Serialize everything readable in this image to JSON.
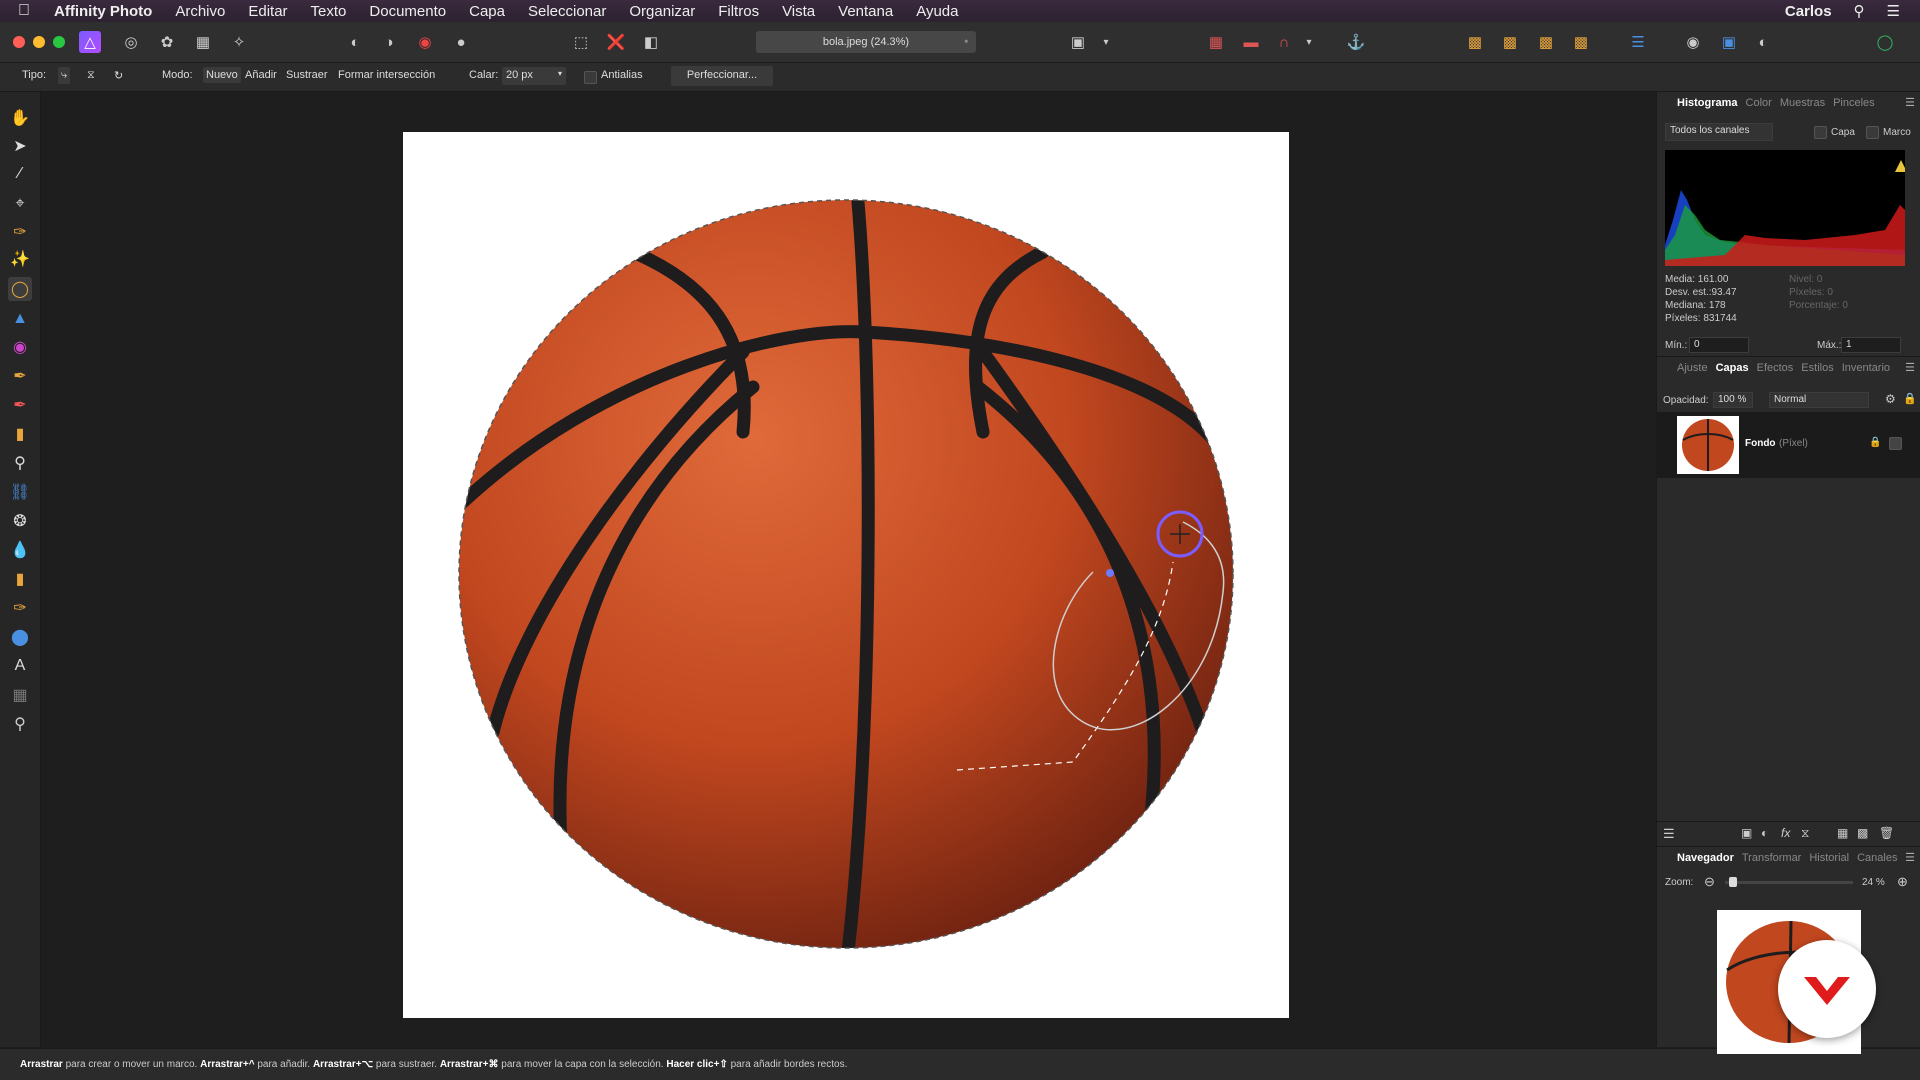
{
  "menubar": {
    "app_name": "Affinity Photo",
    "items": [
      "Archivo",
      "Editar",
      "Texto",
      "Documento",
      "Capa",
      "Seleccionar",
      "Organizar",
      "Filtros",
      "Vista",
      "Ventana",
      "Ayuda"
    ],
    "user": "Carlos"
  },
  "toolbar": {
    "document_tab": "bola.jpeg (24.3%)"
  },
  "context_bar": {
    "type_label": "Tipo:",
    "mode_label": "Modo:",
    "modes": [
      "Nuevo",
      "Añadir",
      "Sustraer",
      "Formar intersección"
    ],
    "feather_label": "Calar:",
    "feather_value": "20 px",
    "antialias_label": "Antialias",
    "refine_button": "Perfeccionar..."
  },
  "status_bar": {
    "parts": [
      {
        "bold": "Arrastrar",
        "text": " para crear o mover un marco. "
      },
      {
        "bold": "Arrastrar+^",
        "text": " para añadir. "
      },
      {
        "bold": "Arrastrar+⌥",
        "text": " para sustraer. "
      },
      {
        "bold": "Arrastrar+⌘",
        "text": " para mover la capa con la selección. "
      },
      {
        "bold": "Hacer clic+⇧",
        "text": " para añadir bordes rectos."
      }
    ]
  },
  "panels": {
    "top_tabs": [
      "Histograma",
      "Color",
      "Muestras",
      "Pinceles"
    ],
    "channels_select": "Todos los canales",
    "layer_checkbox": "Capa",
    "frame_checkbox": "Marco",
    "stats": {
      "media": "Media: 161.00",
      "desv": "Desv. est.:93.47",
      "mediana": "Mediana: 178",
      "pixeles": "Píxeles: 831744",
      "nivel": "Nivel: 0",
      "pixeles_r": "Píxeles: 0",
      "porcentaje": "Porcentaje: 0"
    },
    "min_label": "Mín.:",
    "min_value": "0",
    "max_label": "Máx.:",
    "max_value": "1",
    "mid_tabs": [
      "Ajuste",
      "Capas",
      "Efectos",
      "Estilos",
      "Inventario"
    ],
    "opacity_label": "Opacidad:",
    "opacity_value": "100 %",
    "blend_mode": "Normal",
    "layer_name": "Fondo",
    "layer_type": "(Píxel)",
    "bottom_tabs": [
      "Navegador",
      "Transformar",
      "Historial",
      "Canales"
    ],
    "zoom_label": "Zoom:",
    "zoom_value": "24 %"
  },
  "colors": {
    "accent": "#7b5cff",
    "ball": "#c1471f"
  }
}
